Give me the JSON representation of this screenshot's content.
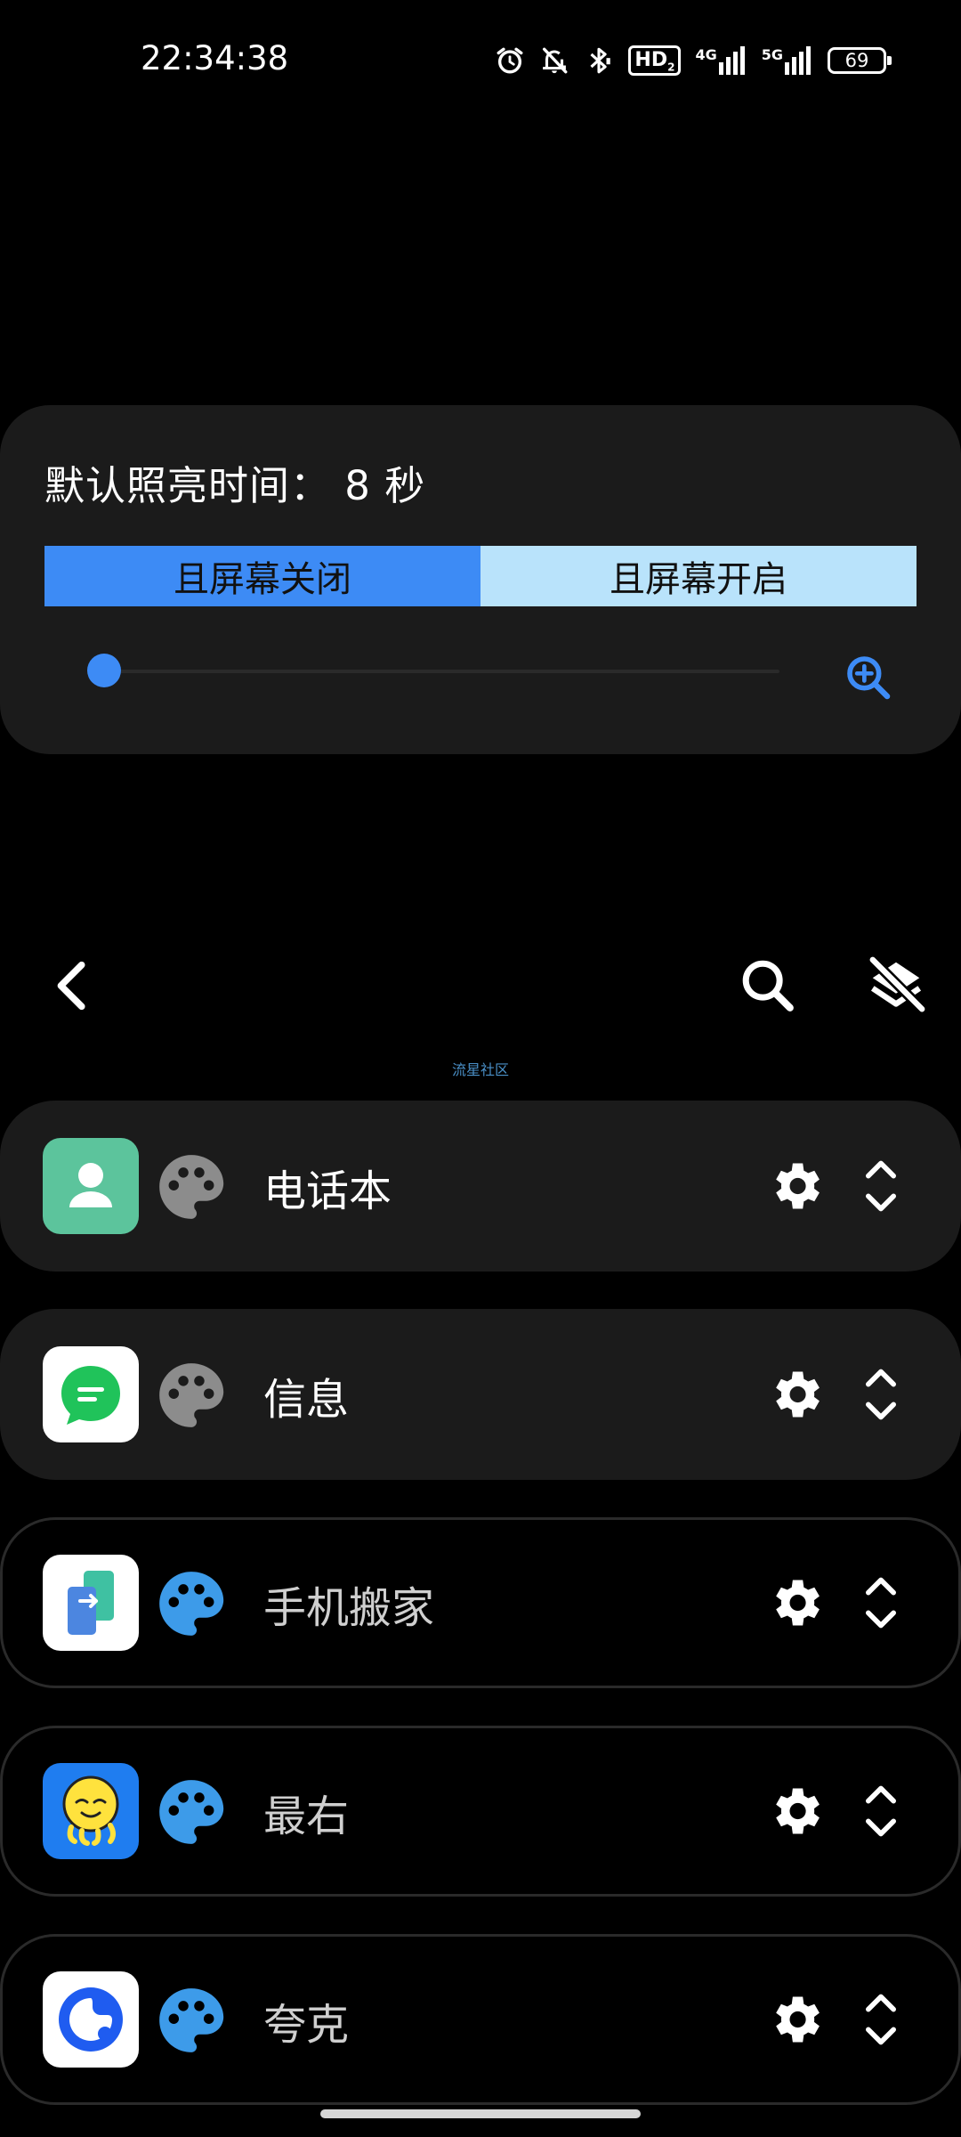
{
  "status_bar": {
    "time": "22:34:38",
    "net_4g": "4G",
    "net_5g": "5G",
    "hd": "HD",
    "hd_sub": "2",
    "battery": "69"
  },
  "panel": {
    "title": "默认照亮时间：  8 秒",
    "segments": [
      "且屏幕关闭",
      "且屏幕开启"
    ],
    "slider_value": 0,
    "accent_color": "#3d8bf5",
    "segment_inactive_color": "#b9e3fb"
  },
  "toolbar": {
    "icons": [
      "back-icon",
      "search-icon",
      "layers-off-icon"
    ]
  },
  "watermark": "流星社区",
  "apps": [
    {
      "name": "电话本",
      "icon": "contacts-icon",
      "palette": "palette-gray"
    },
    {
      "name": "信息",
      "icon": "messages-icon",
      "palette": "palette-gray"
    },
    {
      "name": "手机搬家",
      "icon": "phone-clone-icon",
      "palette": "palette-blue"
    },
    {
      "name": "最右",
      "icon": "zuiyou-icon",
      "palette": "palette-blue"
    },
    {
      "name": "夸克",
      "icon": "quark-icon",
      "palette": "palette-blue"
    }
  ]
}
